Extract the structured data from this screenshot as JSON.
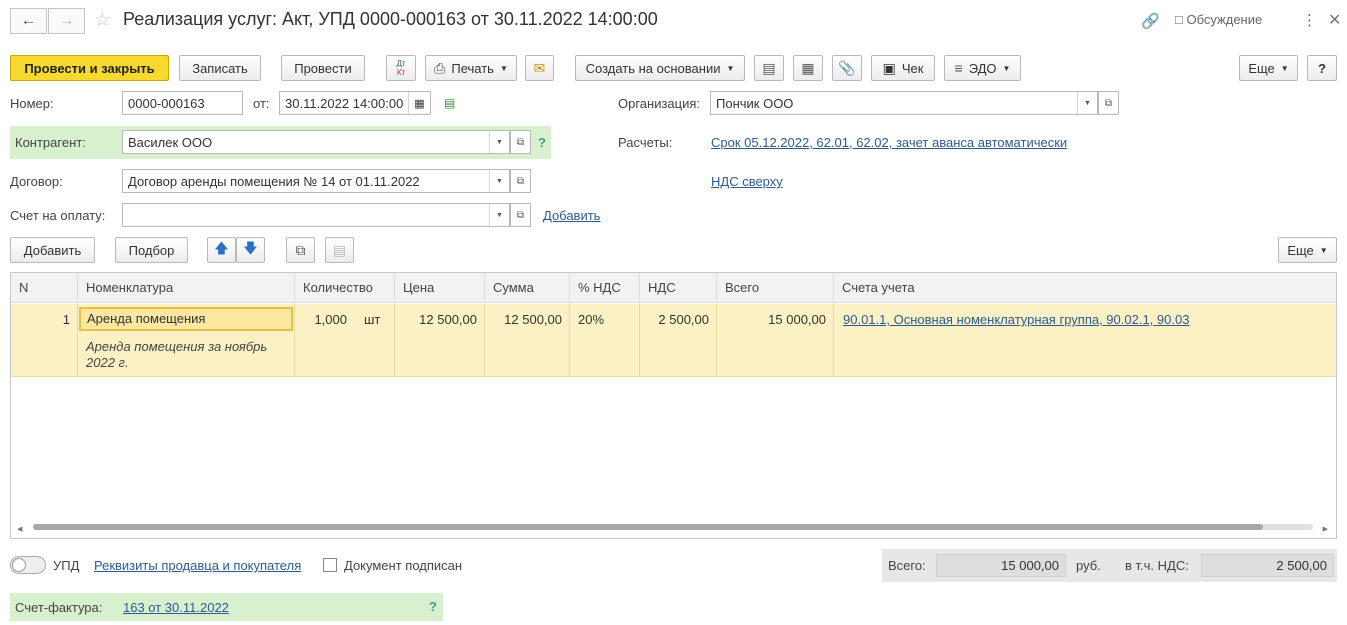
{
  "header": {
    "title": "Реализация услуг: Акт, УПД 0000-000163 от 30.11.2022 14:00:00",
    "discussion": "Обсуждение"
  },
  "toolbar": {
    "post_close": "Провести и закрыть",
    "save": "Записать",
    "post": "Провести",
    "dt_kt_top": "Дт",
    "dt_kt_bottom": "Кт",
    "print": "Печать",
    "create_based": "Создать на основании",
    "receipt": "Чек",
    "edo": "ЭДО",
    "more": "Еще",
    "help": "?"
  },
  "form": {
    "number_label": "Номер:",
    "number_value": "0000-000163",
    "from_label": "от:",
    "date_value": "30.11.2022 14:00:00",
    "org_label": "Организация:",
    "org_value": "Пончик ООО",
    "counterparty_label": "Контрагент:",
    "counterparty_value": "Василек ООО",
    "counterparty_help": "?",
    "settlements_label": "Расчеты:",
    "settlements_link": "Срок 05.12.2022, 62.01, 62.02, зачет аванса автоматически",
    "contract_label": "Договор:",
    "contract_value": "Договор аренды помещения № 14 от 01.11.2022",
    "vat_link": "НДС сверху",
    "invoice_label": "Счет на оплату:",
    "invoice_value": "",
    "add_link": "Добавить"
  },
  "table_toolbar": {
    "add": "Добавить",
    "pick": "Подбор",
    "more": "Еще"
  },
  "table": {
    "columns": [
      "N",
      "Номенклатура",
      "Количество",
      "Цена",
      "Сумма",
      "% НДС",
      "НДС",
      "Всего",
      "Счета учета"
    ],
    "rows": [
      {
        "n": "1",
        "item": "Аренда помещения",
        "item_desc": "Аренда помещения за ноябрь 2022 г.",
        "qty": "1,000",
        "unit": "шт",
        "price": "12 500,00",
        "sum": "12 500,00",
        "vat_rate": "20%",
        "vat": "2 500,00",
        "total": "15 000,00",
        "accounts": "90.01.1, Основная номенклатурная группа, 90.02.1, 90.03"
      }
    ]
  },
  "footer": {
    "upd_label": "УПД",
    "requisites_link": "Реквизиты продавца и покупателя",
    "signed_label": "Документ подписан",
    "total_label": "Всего:",
    "total_value": "15 000,00",
    "currency": "руб.",
    "vat_incl_label": "в т.ч. НДС:",
    "vat_incl_value": "2 500,00",
    "invoice_doc_label": "Счет-фактура:",
    "invoice_doc_link": "163 от 30.11.2022",
    "invoice_doc_help": "?"
  }
}
